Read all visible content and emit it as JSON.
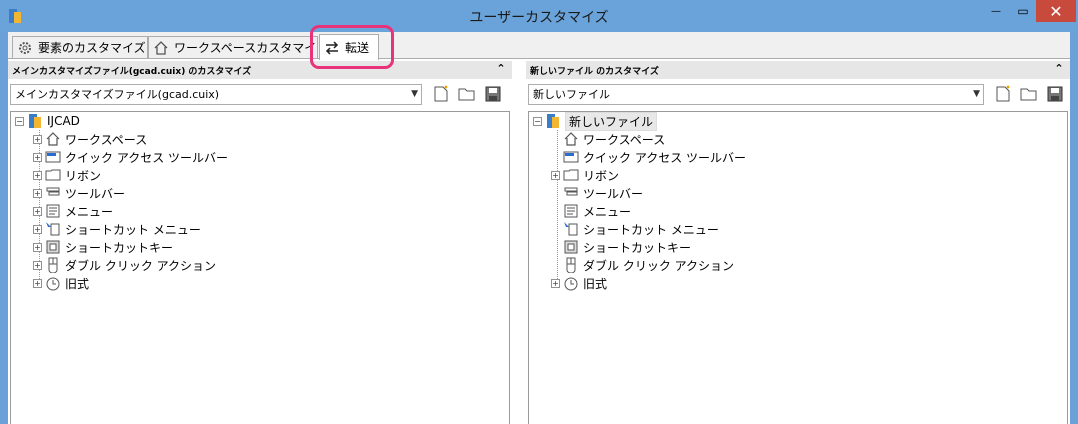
{
  "window": {
    "title": "ユーザーカスタマイズ",
    "close_glyph": "✕",
    "minimize_glyph": "—",
    "maximize_glyph": "▭",
    "accent_color": "#6aa3da",
    "close_color": "#c74a3d"
  },
  "tabs": [
    {
      "label": "要素のカスタマイズ",
      "icon": "gear-icon"
    },
    {
      "label": "ワークスペースカスタマイズ",
      "icon": "home-icon"
    },
    {
      "label": "転送",
      "icon": "transfer-arrows-icon",
      "selected": true
    }
  ],
  "highlight_color": "#e8327a",
  "left_panel": {
    "header": "メインカスタマイズファイル(gcad.cuix) のカスタマイズ",
    "combo_value": "メインカスタマイズファイル(gcad.cuix)",
    "tree": {
      "root": "IJCAD",
      "items": [
        "ワークスペース",
        "クイック アクセス ツールバー",
        "リボン",
        "ツールバー",
        "メニュー",
        "ショートカット メニュー",
        "ショートカットキー",
        "ダブル クリック アクション",
        "旧式"
      ]
    }
  },
  "right_panel": {
    "header": "新しいファイル のカスタマイズ",
    "combo_value": "新しいファイル",
    "tree": {
      "root": "新しいファイル",
      "items": [
        "ワークスペース",
        "クイック アクセス ツールバー",
        "リボン",
        "ツールバー",
        "メニュー",
        "ショートカット メニュー",
        "ショートカットキー",
        "ダブル クリック アクション",
        "旧式"
      ]
    }
  },
  "icons": [
    "workspace-home-icon",
    "quick-access-toolbar-icon",
    "ribbon-icon",
    "toolbar-icon",
    "menu-icon",
    "shortcut-menu-icon",
    "shortcut-key-icon",
    "double-click-icon",
    "legacy-clock-icon"
  ]
}
